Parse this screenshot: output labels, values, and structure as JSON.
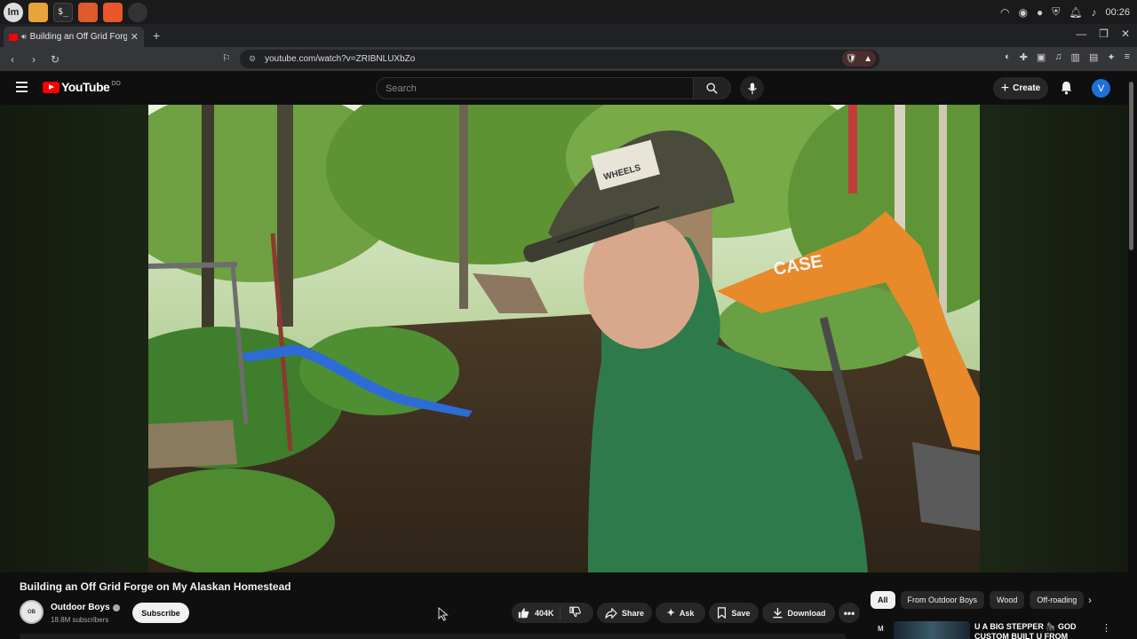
{
  "taskbar": {
    "apps": [
      "mint-menu",
      "files",
      "terminal",
      "firefox",
      "brave",
      "settings"
    ],
    "clock": "00:26"
  },
  "browser": {
    "tab_title": "Building an Off Grid Forge on My Alaskan Homestead",
    "url": "youtube.com/watch?v=ZRIBNLUXbZo"
  },
  "youtube": {
    "logo_text": "YouTube",
    "logo_country": "DO",
    "search_placeholder": "Search",
    "create_label": "Create",
    "avatar_letter": "V"
  },
  "video": {
    "title": "Building an Off Grid Forge on My Alaskan Homestead",
    "excavator_brand": "CASE",
    "cap_text": "WHEELS"
  },
  "channel": {
    "name": "Outdoor Boys",
    "subscribers": "18.8M subscribers",
    "subscribe_label": "Subscribe"
  },
  "actions": {
    "likes": "404K",
    "share": "Share",
    "ask": "Ask",
    "save": "Save",
    "download": "Download"
  },
  "chips": [
    "All",
    "From Outdoor Boys",
    "Wood",
    "Off-roading"
  ],
  "recommendation": {
    "channel_logo": "M",
    "title": "U A BIG STEPPER 🦍 GOD CUSTOM BUILT U FROM"
  }
}
